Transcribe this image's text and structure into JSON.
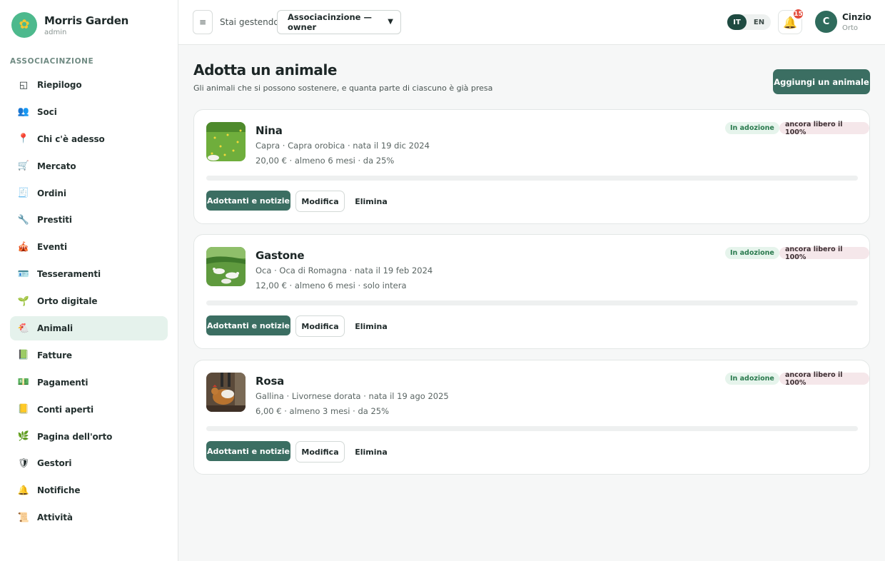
{
  "brand": {
    "name": "Morris Garden",
    "role": "admin",
    "logo_icon": "flower-icon"
  },
  "sidebar": {
    "section": "ASSOCIACINZIONE",
    "items": [
      {
        "label": "Riepilogo",
        "icon": "◱",
        "active": false
      },
      {
        "label": "Soci",
        "icon": "👥",
        "active": false
      },
      {
        "label": "Chi c'è adesso",
        "icon": "📍",
        "active": false
      },
      {
        "label": "Mercato",
        "icon": "🛒",
        "active": false
      },
      {
        "label": "Ordini",
        "icon": "🧾",
        "active": false
      },
      {
        "label": "Prestiti",
        "icon": "🔧",
        "active": false
      },
      {
        "label": "Eventi",
        "icon": "🎪",
        "active": false
      },
      {
        "label": "Tesseramenti",
        "icon": "🪪",
        "active": false
      },
      {
        "label": "Orto digitale",
        "icon": "🌱",
        "active": false
      },
      {
        "label": "Animali",
        "icon": "🐔",
        "active": true
      },
      {
        "label": "Fatture",
        "icon": "📗",
        "active": false
      },
      {
        "label": "Pagamenti",
        "icon": "💵",
        "active": false
      },
      {
        "label": "Conti aperti",
        "icon": "📒",
        "active": false
      },
      {
        "label": "Pagina dell'orto",
        "icon": "🌿",
        "active": false
      },
      {
        "label": "Gestori",
        "icon": "🛡",
        "active": false
      },
      {
        "label": "Notifiche",
        "icon": "🔔",
        "active": false
      },
      {
        "label": "Attività",
        "icon": "📜",
        "active": false
      }
    ]
  },
  "topbar": {
    "menu_icon": "≡",
    "managing_label": "Stai gestendo",
    "managing_value": "Associacinzione — owner",
    "languages": [
      "IT",
      "EN"
    ],
    "active_language": "IT",
    "notification_count": "15",
    "user": {
      "initial": "C",
      "name": "Cinzio",
      "subtitle": "Orto"
    }
  },
  "main": {
    "title": "Adotta un animale",
    "subtitle": "Gli animali che si possono sostenere, e quanta parte di ciascuno è già presa",
    "add_button": "Aggiungi un animale",
    "actions": {
      "primary": "Adottanti e notizie",
      "edit": "Modifica",
      "delete": "Elimina"
    },
    "animals": [
      {
        "name": "Nina",
        "species": "Capra · Capra orobica · nata il 19 dic 2024",
        "price": "20,00 € · almeno 6 mesi · da 25%",
        "status": "In adozione",
        "availability": "ancora libero il 100%",
        "adopted_fraction": 0
      },
      {
        "name": "Gastone",
        "species": "Oca · Oca di Romagna · nata il 19 feb 2024",
        "price": "12,00 € · almeno 6 mesi · solo intera",
        "status": "In adozione",
        "availability": "ancora libero il 100%",
        "adopted_fraction": 0
      },
      {
        "name": "Rosa",
        "species": "Gallina · Livornese dorata · nata il 19 ago 2025",
        "price": "6,00 € · almeno 3 mesi · da 25%",
        "status": "In adozione",
        "availability": "ancora libero il 100%",
        "adopted_fraction": 0
      }
    ]
  }
}
